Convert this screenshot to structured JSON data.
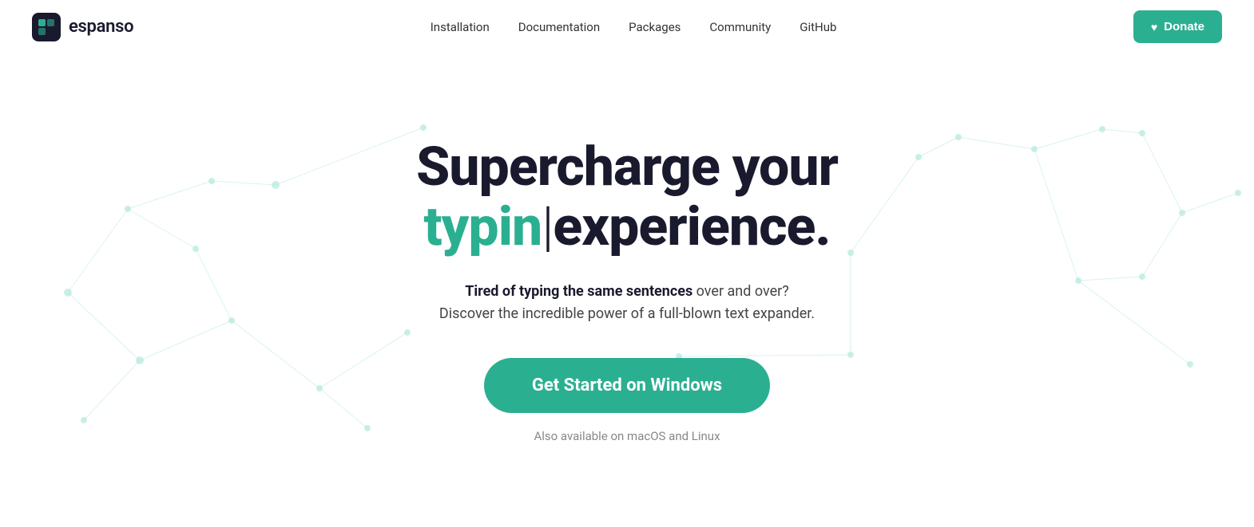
{
  "header": {
    "logo_text": "espanso",
    "nav": {
      "items": [
        {
          "label": "Installation",
          "href": "#"
        },
        {
          "label": "Documentation",
          "href": "#"
        },
        {
          "label": "Packages",
          "href": "#"
        },
        {
          "label": "Community",
          "href": "#"
        },
        {
          "label": "GitHub",
          "href": "#"
        }
      ]
    },
    "donate_button": "Donate"
  },
  "hero": {
    "title_line1": "Supercharge your",
    "title_typing": "typin",
    "title_cursor": "|",
    "title_rest": "experience.",
    "subtitle_bold": "Tired of typing the same sentences",
    "subtitle_rest": " over and over?\nDiscover the incredible power of a full-blown text expander.",
    "cta_label": "Get Started on Windows",
    "available_label": "Also available on macOS and Linux"
  },
  "colors": {
    "accent": "#2baf91",
    "dark": "#1a1a2e",
    "network": "#b2e8de"
  }
}
